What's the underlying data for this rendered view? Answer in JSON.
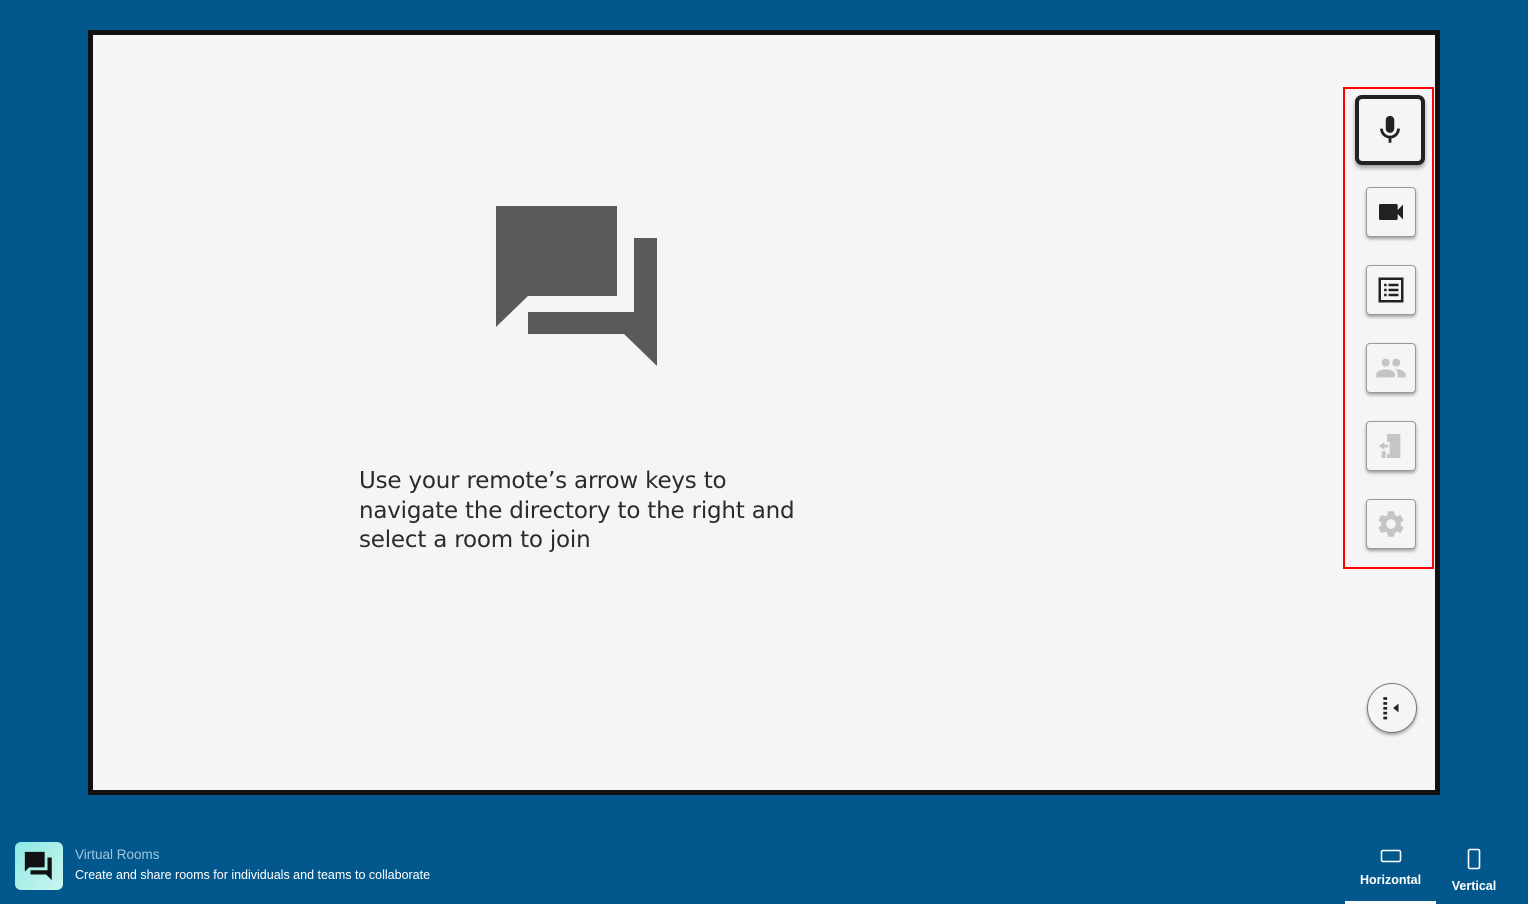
{
  "main": {
    "instructions": "Use your remote’s arrow keys to navigate the directory to the right and select a room to join"
  },
  "toolbar": {
    "buttons": [
      {
        "name": "microphone",
        "icon": "mic-icon",
        "state": "focused"
      },
      {
        "name": "camera",
        "icon": "videocam-icon",
        "state": "enabled"
      },
      {
        "name": "directory",
        "icon": "list-icon",
        "state": "enabled"
      },
      {
        "name": "participants",
        "icon": "people-icon",
        "state": "disabled"
      },
      {
        "name": "leave",
        "icon": "exit-door-icon",
        "state": "disabled"
      },
      {
        "name": "settings",
        "icon": "gear-icon",
        "state": "disabled"
      }
    ],
    "collapse_icon": "collapse-panel-icon"
  },
  "footer": {
    "app_title": "Virtual Rooms",
    "app_description": "Create and share rooms for individuals and teams to collaborate",
    "orientation_tabs": [
      {
        "label": "Horizontal",
        "icon": "landscape-icon",
        "active": true
      },
      {
        "label": "Vertical",
        "icon": "portrait-icon",
        "active": false
      }
    ]
  },
  "colors": {
    "background": "#02588c",
    "screen": "#f5f5f5",
    "highlight_outline": "#ff0000",
    "icon_dark": "#222222",
    "icon_disabled": "#c4c4c4",
    "hero_icon": "#5a5a5a"
  }
}
